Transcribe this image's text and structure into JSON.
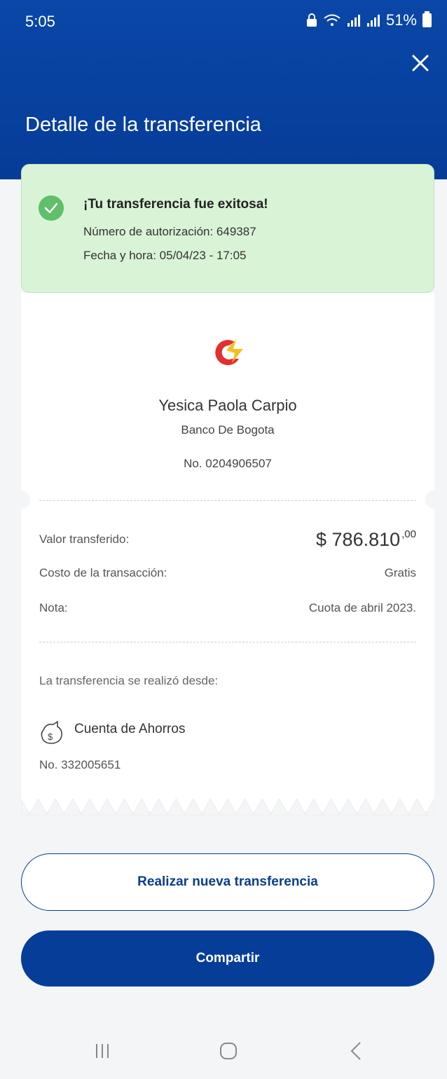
{
  "status_bar": {
    "time": "5:05",
    "battery": "51%"
  },
  "header": {
    "title": "Detalle de la transferencia"
  },
  "success": {
    "title": "¡Tu transferencia fue exitosa!",
    "authorization": "Número de autorización: 649387",
    "datetime": "Fecha y hora: 05/04/23 - 17:05"
  },
  "recipient": {
    "name": "Yesica Paola Carpio",
    "bank": "Banco De Bogota",
    "account": "No. 0204906507"
  },
  "details": {
    "amount_label": "Valor transferido:",
    "amount_main": "$ 786.810",
    "amount_cents": ",00",
    "cost_label": "Costo de la transacción:",
    "cost_value": "Gratis",
    "note_label": "Nota:",
    "note_value": "Cuota de abril 2023."
  },
  "source": {
    "label": "La transferencia se realizó desde:",
    "account_type": "Cuenta de Ahorros",
    "account_number": "No. 332005651"
  },
  "actions": {
    "new_transfer": "Realizar nueva transferencia",
    "share": "Compartir"
  },
  "colors": {
    "primary": "#063d98",
    "success_bg": "#d9f3d6",
    "success_icon": "#5fbf6a"
  }
}
